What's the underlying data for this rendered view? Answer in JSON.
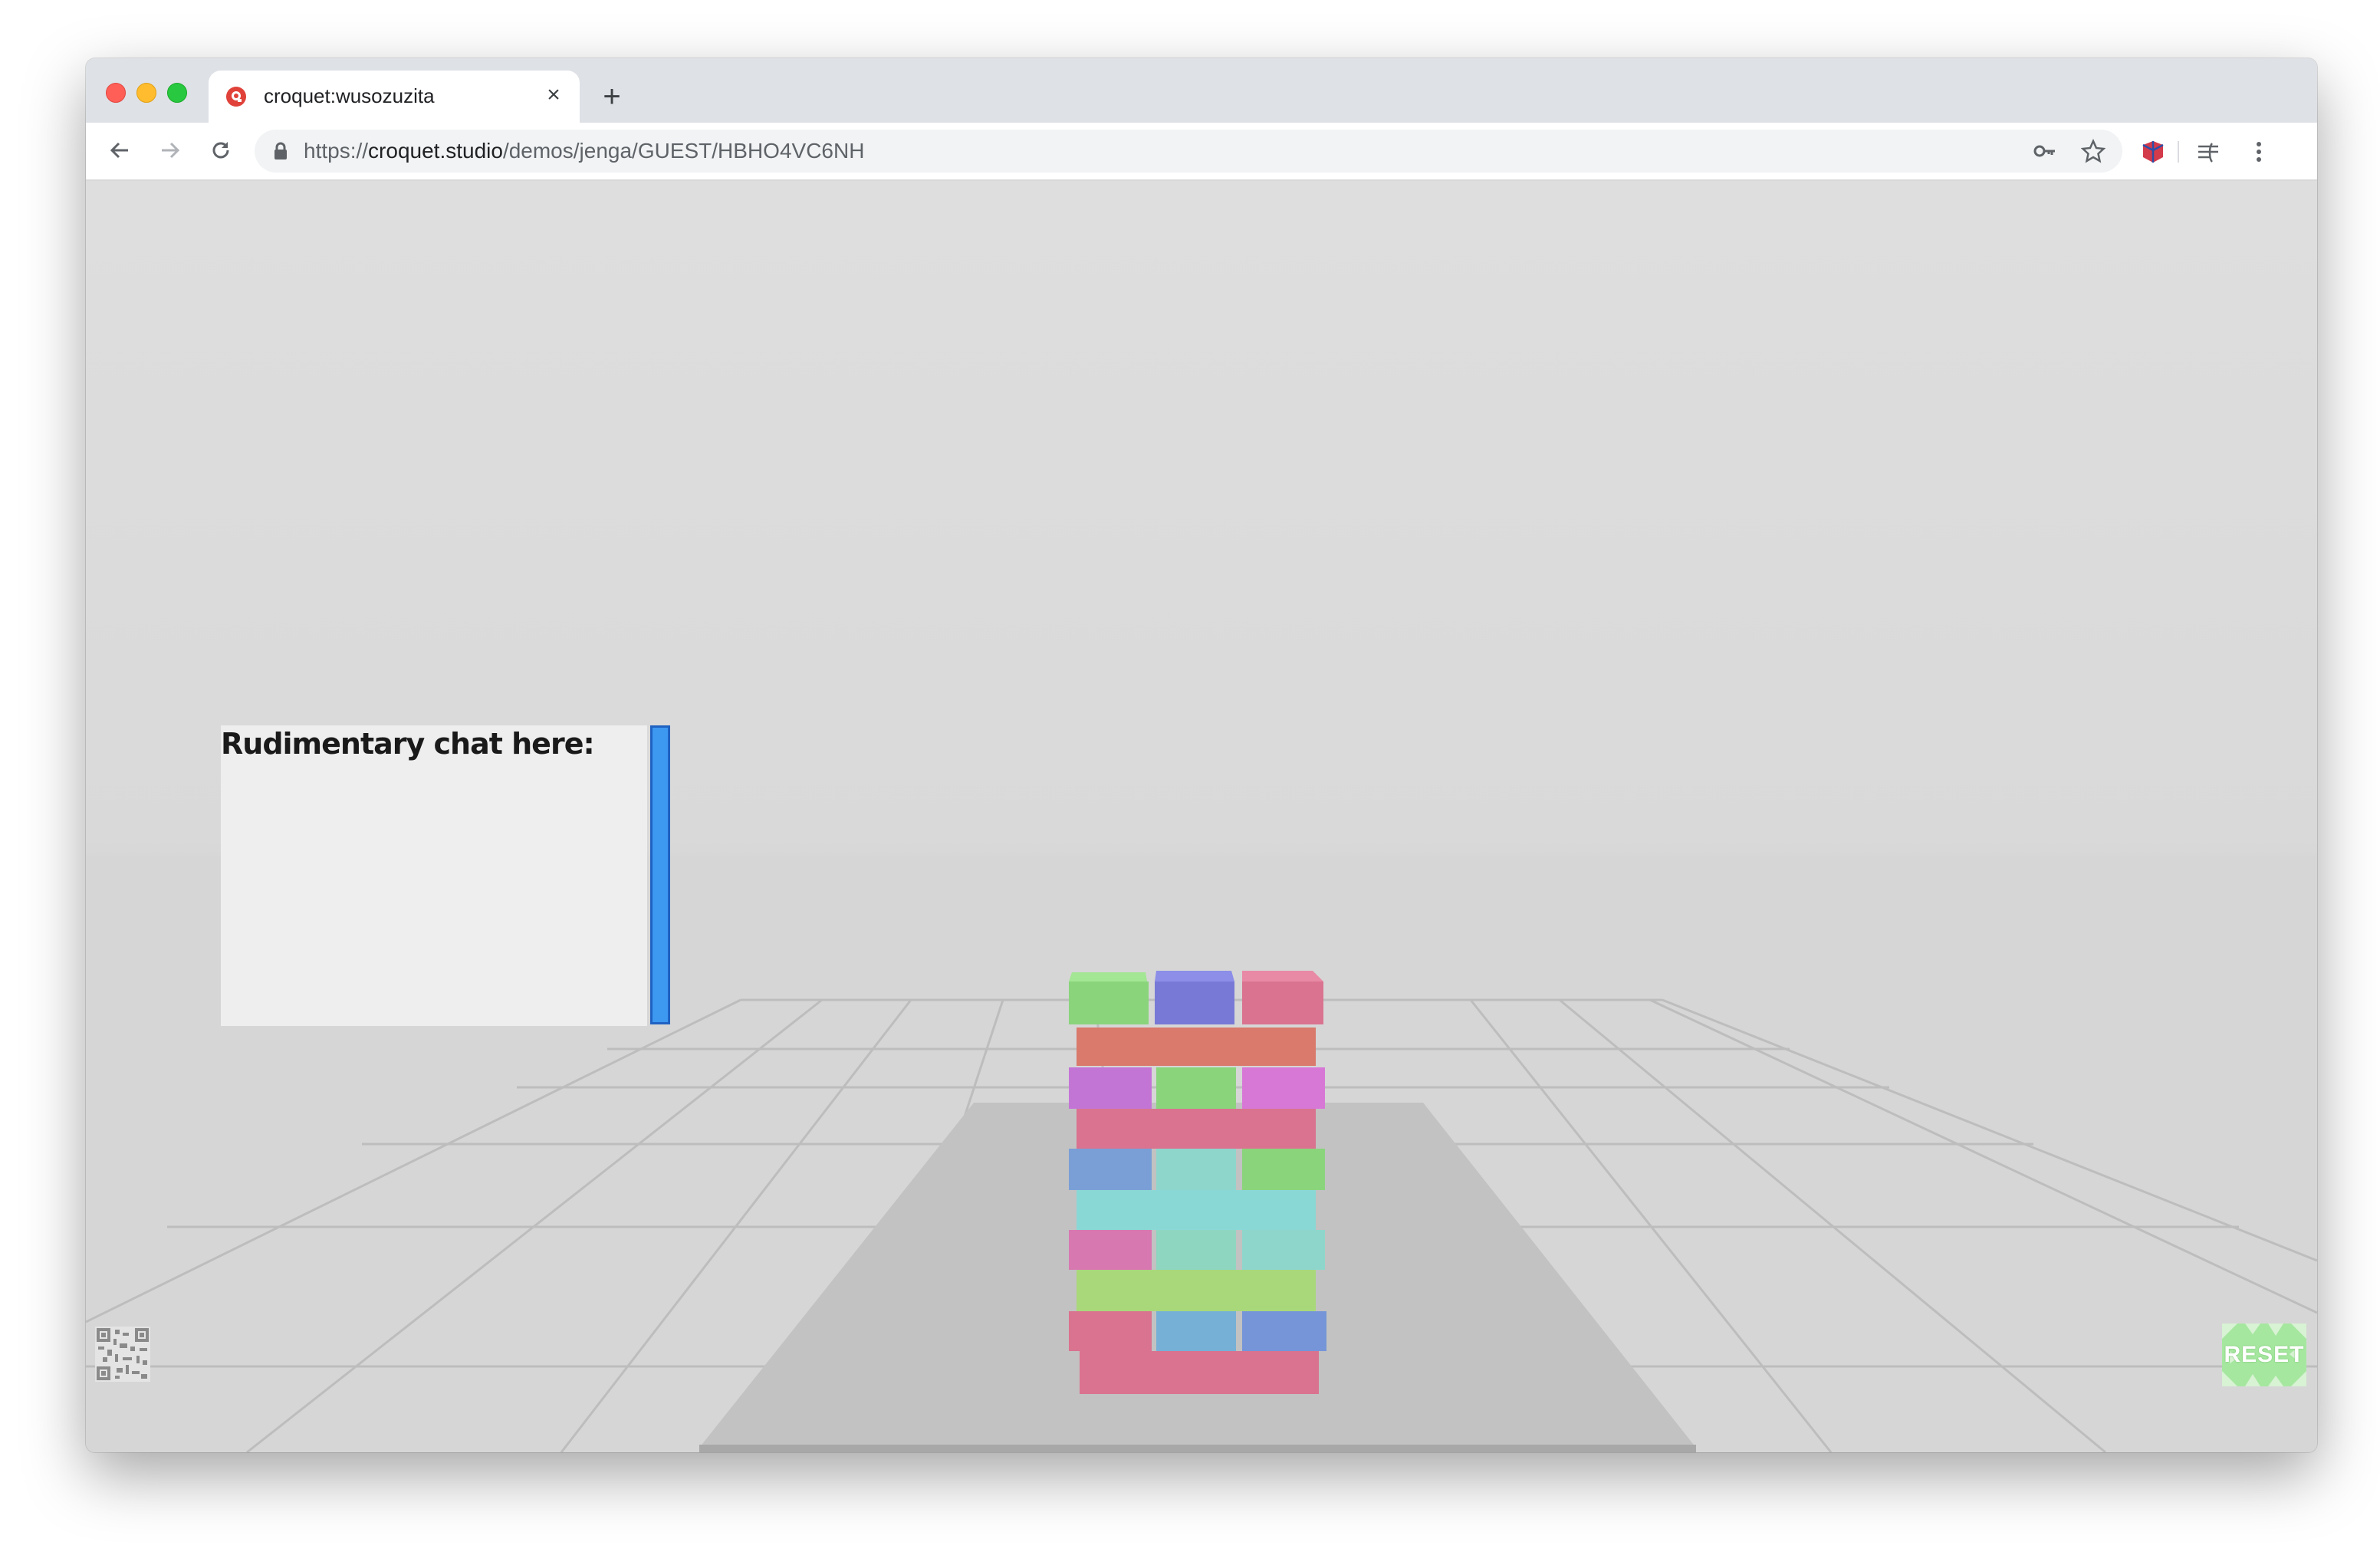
{
  "browser": {
    "tab": {
      "title": "croquet:wusozuzita"
    },
    "address_bar": {
      "scheme": "https://",
      "host": "croquet.studio",
      "path": "/demos/jenga/GUEST/HBHO4VC6NH"
    },
    "icons": [
      "back-icon",
      "forward-icon",
      "reload-icon",
      "lock-icon",
      "key-icon",
      "star-icon",
      "extension-icon",
      "reader-icon",
      "menu-icon",
      "new-tab-icon",
      "close-tab-icon"
    ]
  },
  "app": {
    "chat": {
      "title": "Rudimentary chat here:"
    },
    "reset_button": {
      "label": "RESET"
    },
    "qr_code": {
      "icon": "qr-code-icon"
    },
    "jenga": {
      "colors": {
        "green": "#8ad47c",
        "blue": "#7879d6",
        "pink": "#d9738f",
        "salmon": "#d97a6c",
        "purple": "#c375d6",
        "magenta": "#d778d6",
        "teal": "#8ed6cc",
        "cyan": "#8ad8d6",
        "lime": "#a9d87a",
        "skyblue": "#76b0d6",
        "steelblue": "#7595d8"
      }
    }
  }
}
